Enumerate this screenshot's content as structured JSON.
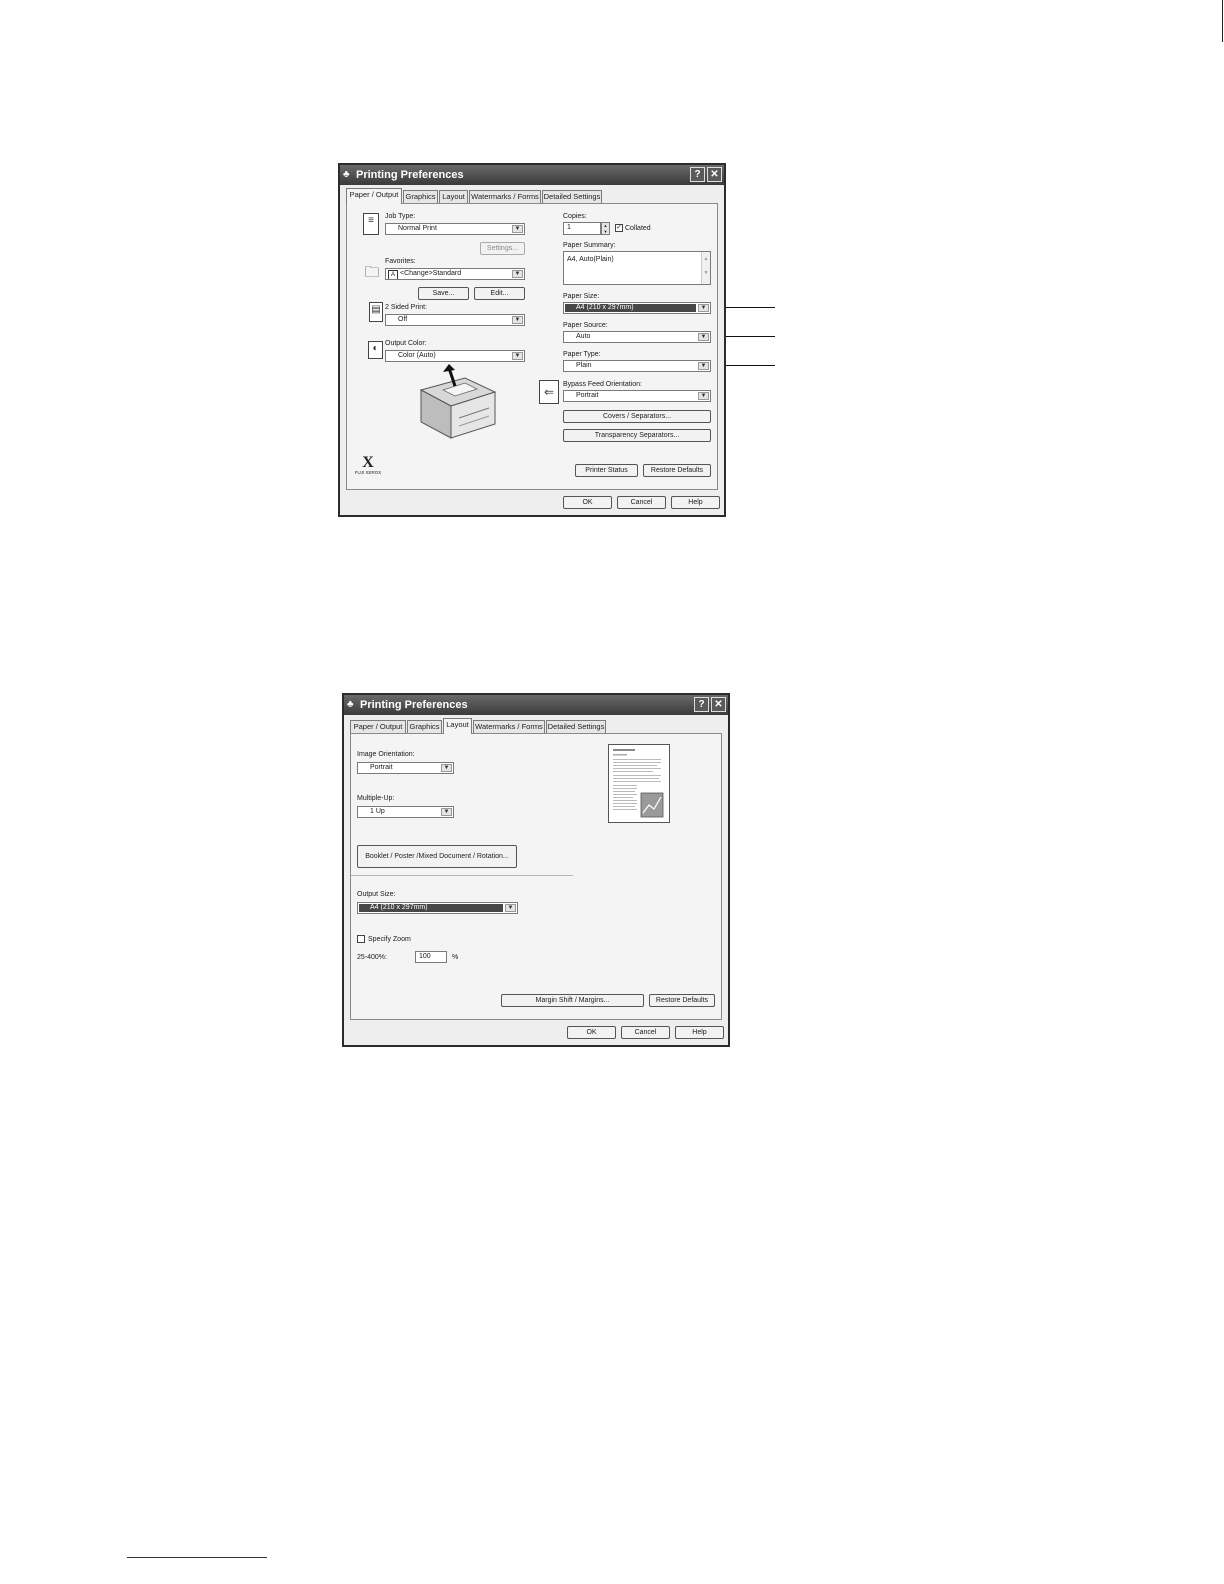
{
  "dialog1": {
    "title": "Printing Preferences",
    "help_glyph": "?",
    "close_glyph": "✕",
    "tabs": [
      "Paper / Output",
      "Graphics",
      "Layout",
      "Watermarks / Forms",
      "Detailed Settings"
    ],
    "active_tab": "Paper / Output",
    "job_type": {
      "label": "Job Type:",
      "value": "Normal Print",
      "settings_button": "Settings..."
    },
    "favorites": {
      "label": "Favorites:",
      "value": "<Change>Standard",
      "save_button": "Save...",
      "edit_button": "Edit..."
    },
    "two_sided": {
      "label": "2 Sided Print:",
      "value": "Off"
    },
    "output_color": {
      "label": "Output Color:",
      "value": "Color (Auto)"
    },
    "copies": {
      "label": "Copies:",
      "value": "1",
      "collated_label": "Collated",
      "collated_checked": true
    },
    "paper_summary": {
      "label": "Paper Summary:",
      "value": "A4, Auto(Plain)"
    },
    "paper_size": {
      "label": "Paper Size:",
      "value": "A4 (210 x 297mm)"
    },
    "paper_source": {
      "label": "Paper Source:",
      "value": "Auto"
    },
    "paper_type": {
      "label": "Paper Type:",
      "value": "Plain"
    },
    "bypass_feed": {
      "label": "Bypass Feed Orientation:",
      "value": "Portrait"
    },
    "covers_button": "Covers / Separators...",
    "transparency_button": "Transparency Separators...",
    "printer_status_button": "Printer Status",
    "restore_defaults_button": "Restore Defaults",
    "logo_mark": "X",
    "logo_text": "FUJI XEROX",
    "ok_button": "OK",
    "cancel_button": "Cancel",
    "help_button": "Help"
  },
  "dialog2": {
    "title": "Printing Preferences",
    "help_glyph": "?",
    "close_glyph": "✕",
    "tabs": [
      "Paper / Output",
      "Graphics",
      "Layout",
      "Watermarks / Forms",
      "Detailed Settings"
    ],
    "active_tab": "Layout",
    "image_orientation": {
      "label": "Image Orientation:",
      "value": "Portrait"
    },
    "multiple_up": {
      "label": "Multiple-Up:",
      "value": "1 Up"
    },
    "booklet_button": "Booklet / Poster /Mixed Document / Rotation...",
    "output_size": {
      "label": "Output Size:",
      "value": "A4 (210 x 297mm)"
    },
    "specify_zoom": {
      "label": "Specify Zoom",
      "checked": false
    },
    "zoom": {
      "label": "25-400%:",
      "value": "100",
      "unit": "%"
    },
    "margin_button": "Margin Shift / Margins...",
    "restore_defaults_button": "Restore Defaults",
    "ok_button": "OK",
    "cancel_button": "Cancel",
    "help_button": "Help"
  }
}
